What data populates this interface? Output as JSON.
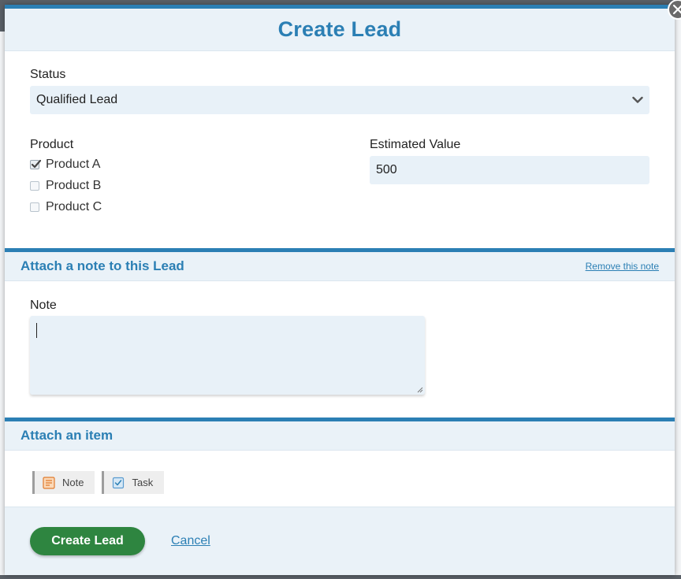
{
  "modal": {
    "title": "Create Lead"
  },
  "form": {
    "status": {
      "label": "Status",
      "selected": "Qualified Lead"
    },
    "product": {
      "label": "Product",
      "options": [
        {
          "label": "Product A",
          "checked": true
        },
        {
          "label": "Product B",
          "checked": false
        },
        {
          "label": "Product C",
          "checked": false
        }
      ]
    },
    "estimated_value": {
      "label": "Estimated Value",
      "value": "500"
    }
  },
  "note_section": {
    "title": "Attach a note to this Lead",
    "remove_link": "Remove this note",
    "note_label": "Note",
    "note_value": ""
  },
  "attach_section": {
    "title": "Attach an item",
    "buttons": [
      {
        "label": "Note",
        "icon": "note-icon"
      },
      {
        "label": "Task",
        "icon": "task-icon"
      }
    ]
  },
  "footer": {
    "submit_label": "Create Lead",
    "cancel_label": "Cancel"
  },
  "colors": {
    "accent": "#2b7fb4",
    "primary_button": "#2e8540",
    "field_bg": "#e8f1f8"
  }
}
